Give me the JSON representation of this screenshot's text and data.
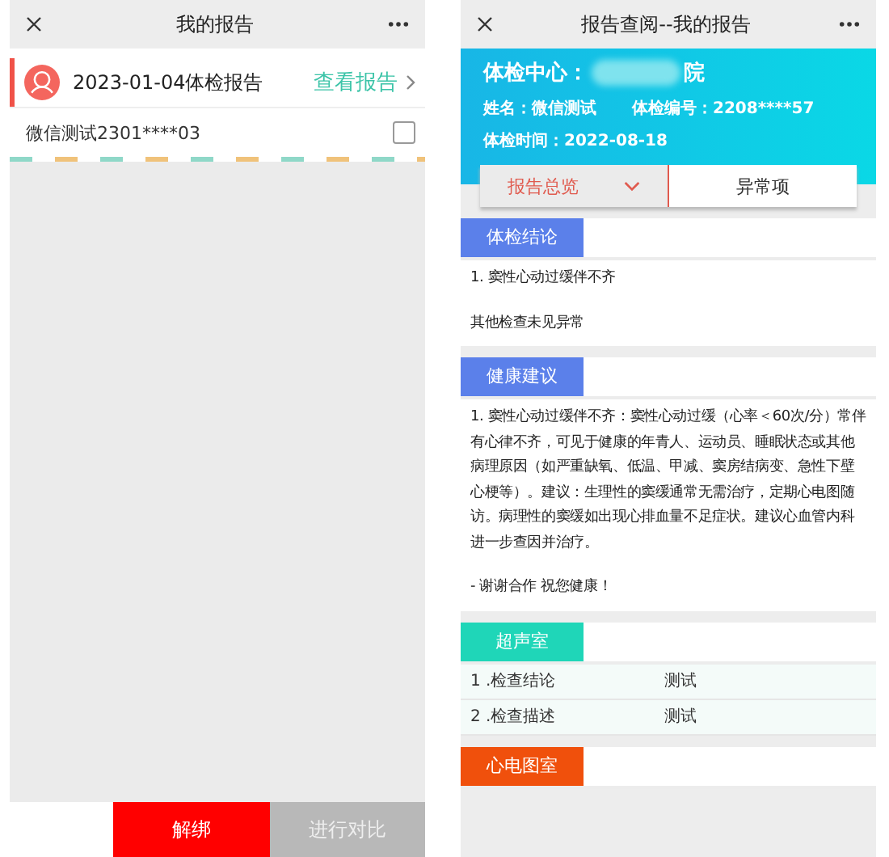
{
  "left": {
    "title": "我的报告",
    "report": {
      "title": "2023-01-04体检报告",
      "action": "查看报告"
    },
    "member": {
      "name": "微信测试2301****03",
      "checked": false
    },
    "buttons": [
      {
        "label": "解绑",
        "kind": "primary"
      },
      {
        "label": "进行对比",
        "kind": "secondary"
      }
    ]
  },
  "right": {
    "title": "报告查阅--我的报告",
    "header": {
      "center_label": "体检中心：",
      "center_suffix": "院",
      "name": "姓名：微信测试",
      "number": "体检编号：2208****57",
      "date": "体检时间：2022-08-18"
    },
    "tabs": [
      {
        "label": "报告总览",
        "selected": true
      },
      {
        "label": "异常项",
        "selected": false
      }
    ],
    "sections": [
      {
        "kind": "text",
        "tag": "体检结论",
        "color": "#5b80ea",
        "paragraphs": [
          "1. 窦性心动过缓伴不齐",
          "其他检查未见异常"
        ]
      },
      {
        "kind": "text",
        "tag": "健康建议",
        "color": "#5b80ea",
        "paragraphs": [
          "1. 窦性心动过缓伴不齐：窦性心动过缓（心率＜60次/分）常伴有心律不齐，可见于健康的年青人、运动员、睡眠状态或其他病理原因（如严重缺氧、低温、甲减、窦房结病变、急性下壁心梗等）。建议：生理性的窦缓通常无需治疗，定期心电图随访。病理性的窦缓如出现心排血量不足症状。建议心血管内科进一步查因并治疗。",
          "- 谢谢合作 祝您健康！"
        ]
      },
      {
        "kind": "table",
        "tag": "超声室",
        "color": "#1fd6b8",
        "rows": [
          [
            "1 .检查结论",
            "测试"
          ],
          [
            "2 .检查描述",
            "测试"
          ]
        ]
      },
      {
        "kind": "table",
        "tag": "心电图室",
        "color": "#f0500c"
      }
    ]
  }
}
